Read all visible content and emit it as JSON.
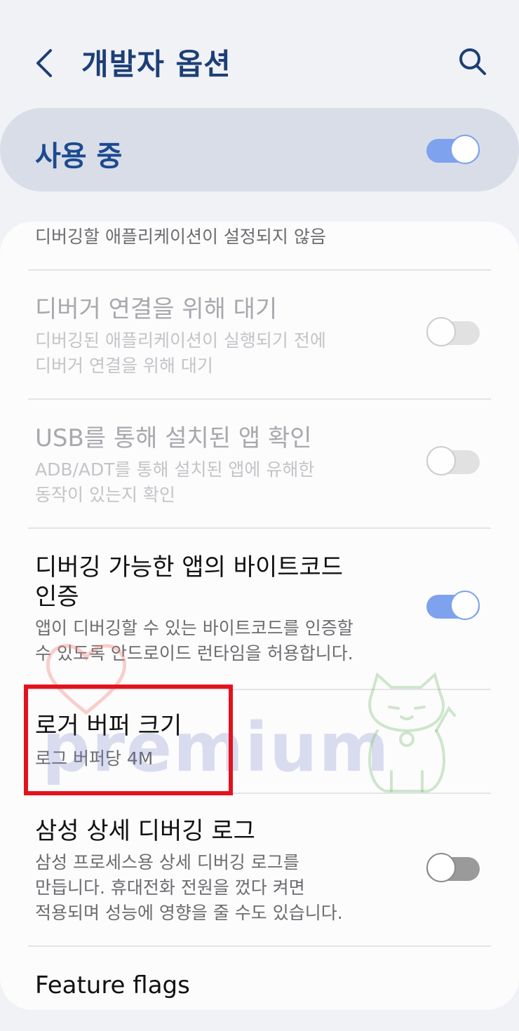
{
  "header": {
    "title": "개발자 옵션",
    "back_icon": "chevron-left-icon",
    "search_icon": "search-icon"
  },
  "master_switch": {
    "label": "사용 중",
    "state": "on"
  },
  "settings": {
    "debug_app_text": "디버깅할 애플리케이션이 설정되지 않음",
    "wait_debugger": {
      "title": "디버거 연결을 위해 대기",
      "sub_line1": "디버깅된 애플리케이션이 실행되기 전에",
      "sub_line2": "디버거 연결을 위해 대기",
      "state": "off",
      "enabled": false
    },
    "verify_usb": {
      "title": "USB를 통해 설치된 앱 확인",
      "sub_line1": "ADB/ADT를 통해 설치된 앱에 유해한",
      "sub_line2": "동작이 있는지 확인",
      "state": "off",
      "enabled": false
    },
    "verify_bytecode": {
      "title_line1": "디버깅 가능한 앱의 바이트코드",
      "title_line2": "인증",
      "sub_line1": "앱이 디버깅할 수 있는 바이트코드를 인증할",
      "sub_line2": "수 있도록 안드로이드 런타임을 허용합니다.",
      "state": "on"
    },
    "logger_buffer": {
      "title": "로거 버퍼 크기",
      "sub": "로그 버퍼당 4M",
      "highlighted": true
    },
    "samsung_debug_log": {
      "title": "삼성 상세 디버깅 로그",
      "sub_line1": "삼성 프로세스용 상세 디버깅 로그를",
      "sub_line2": "만듭니다. 휴대전화 전원을 껐다 켜면",
      "sub_line3": "적용되며 성능에 영향을 줄 수도 있습니다.",
      "state": "off"
    },
    "feature_flags": {
      "title": "Feature flags"
    }
  },
  "watermark": {
    "text": "premium"
  },
  "colors": {
    "title": "#1d3f77",
    "toggle_on": "#7ea2ee",
    "master_bg": "#d8dde8",
    "highlight": "#e4121c"
  }
}
